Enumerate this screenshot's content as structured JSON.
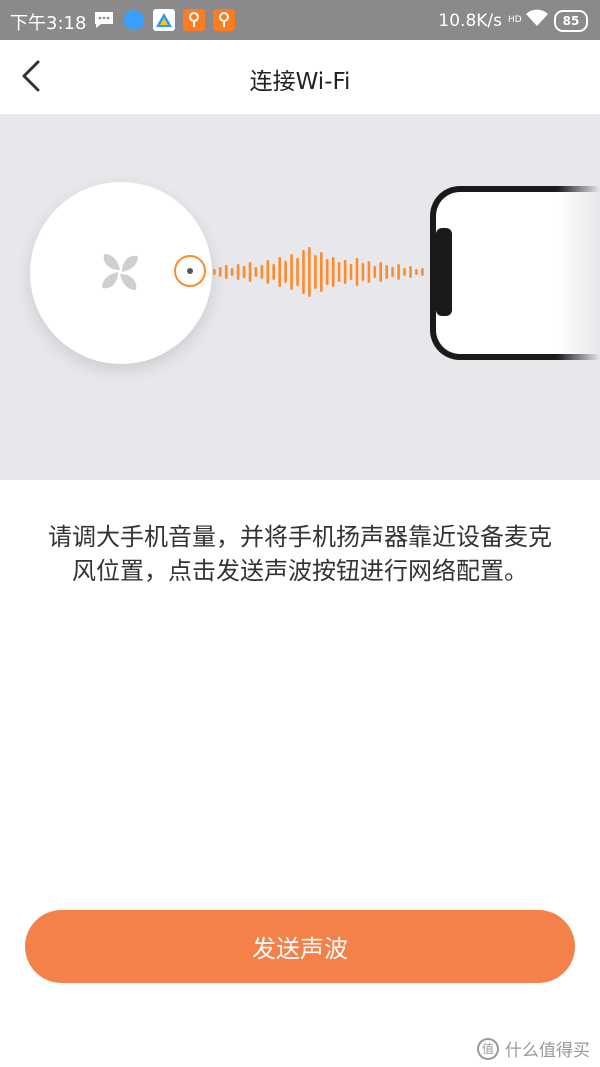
{
  "status_bar": {
    "time": "下午3:18",
    "network_speed": "10.8K/s",
    "network_type": "HD",
    "battery": "85",
    "notification_icons": [
      "message-icon",
      "browser-icon",
      "drive-icon",
      "app-icon",
      "app-icon"
    ]
  },
  "header": {
    "title": "连接Wi-Fi",
    "back_icon": "chevron-left-icon"
  },
  "illustration": {
    "device_icon": "fan-logo-icon",
    "accent_color": "#ff8a2a"
  },
  "instruction": {
    "text": "请调大手机音量，并将手机扬声器靠近设备麦克风位置，点击发送声波按钮进行网络配置。"
  },
  "action": {
    "send_label": "发送声波",
    "color": "#f4804a"
  },
  "watermark": {
    "icon_char": "值",
    "text": "什么值得买"
  }
}
